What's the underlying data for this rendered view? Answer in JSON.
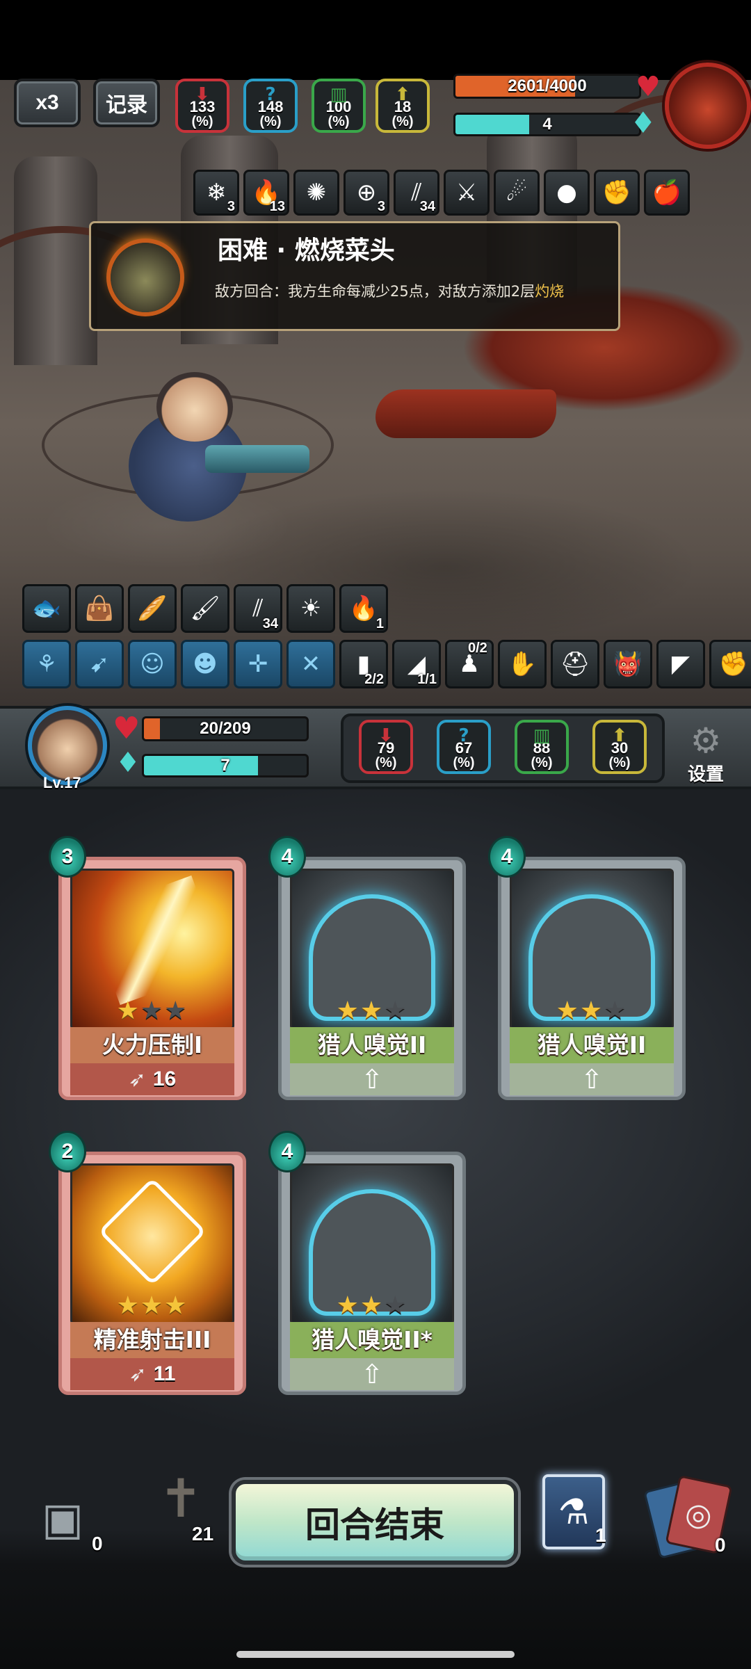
{
  "top": {
    "speed_label": "x3",
    "record_label": "记录",
    "enemy_stats": [
      {
        "icon": "attack-icon",
        "value": "133",
        "unit": "(%)",
        "color": "#c8323a"
      },
      {
        "icon": "mystery-icon",
        "value": "148",
        "unit": "(%)",
        "color": "#2a9fc8"
      },
      {
        "icon": "defense-icon",
        "value": "100",
        "unit": "(%)",
        "color": "#3aa84a"
      },
      {
        "icon": "crit-icon",
        "value": "18",
        "unit": "(%)",
        "color": "#c8b83a"
      }
    ],
    "boss_hp": {
      "text": "2601/4000",
      "fraction": 0.65,
      "color": "#e0642a"
    },
    "boss_energy": {
      "text": "4",
      "fraction": 0.4,
      "color": "#4fd8d0"
    }
  },
  "enemy_buffs": [
    {
      "icon": "snowflake-icon",
      "glyph": "❄",
      "count": "3"
    },
    {
      "icon": "burn-icon",
      "glyph": "🔥",
      "count": "13"
    },
    {
      "icon": "rage-icon",
      "glyph": "✺",
      "count": ""
    },
    {
      "icon": "target-icon",
      "glyph": "⊕",
      "count": "3"
    },
    {
      "icon": "claw-icon",
      "glyph": "⫽",
      "count": "34"
    },
    {
      "icon": "blade-icon",
      "glyph": "⚔",
      "count": ""
    },
    {
      "icon": "flaming-head-icon",
      "glyph": "☄",
      "count": ""
    },
    {
      "icon": "bomb-icon",
      "glyph": "●",
      "count": ""
    },
    {
      "icon": "fist-icon",
      "glyph": "✊",
      "count": ""
    },
    {
      "icon": "apple-icon",
      "glyph": "🍎",
      "count": ""
    }
  ],
  "tooltip": {
    "title": "困难 · 燃烧菜头",
    "desc_prefix": "敌方回合：我方生命每减少25点，对敌方添加2层",
    "keyword": "灼烧"
  },
  "player_buffs": [
    {
      "icon": "fish-icon",
      "glyph": "🐟",
      "count": ""
    },
    {
      "icon": "bag-icon",
      "glyph": "👜",
      "count": ""
    },
    {
      "icon": "bread-icon",
      "glyph": "🥖",
      "count": ""
    },
    {
      "icon": "brush-icon",
      "glyph": "🖌",
      "count": ""
    },
    {
      "icon": "claw-icon",
      "glyph": "⫽",
      "count": "34"
    },
    {
      "icon": "sun-icon",
      "glyph": "☀",
      "count": ""
    },
    {
      "icon": "burn-icon",
      "glyph": "🔥",
      "count": "1"
    }
  ],
  "player_equipment": [
    {
      "icon": "sprout-icon",
      "glyph": "⚘",
      "count": "",
      "blue": true
    },
    {
      "icon": "bow-icon",
      "glyph": "➹",
      "count": "",
      "blue": true
    },
    {
      "icon": "mask-icon",
      "glyph": "☺",
      "count": "",
      "blue": true
    },
    {
      "icon": "pumpkin-icon",
      "glyph": "☻",
      "count": "",
      "blue": true
    },
    {
      "icon": "crosshair-icon",
      "glyph": "✛",
      "count": "",
      "blue": true
    },
    {
      "icon": "crossed-arrows-icon",
      "glyph": "✕",
      "count": "",
      "blue": true
    },
    {
      "icon": "bullet-icon",
      "glyph": "▮",
      "count": "2/2",
      "blue": false
    },
    {
      "icon": "shell-icon",
      "glyph": "◢",
      "count": "1/1",
      "blue": false
    },
    {
      "icon": "figure-icon",
      "glyph": "♟",
      "count": "0/2",
      "blue": false,
      "top": true
    },
    {
      "icon": "glove-icon",
      "glyph": "✋",
      "count": "",
      "blue": false
    },
    {
      "icon": "helmet-icon",
      "glyph": "⛑",
      "count": "",
      "blue": false
    },
    {
      "icon": "monster-icon",
      "glyph": "👹",
      "count": "",
      "blue": false
    },
    {
      "icon": "gun-icon",
      "glyph": "◤",
      "count": "",
      "blue": false
    },
    {
      "icon": "gauntlet-icon",
      "glyph": "✊",
      "count": "",
      "blue": false
    }
  ],
  "player": {
    "level": "Lv.17",
    "hp": {
      "text": "20/209",
      "fraction": 0.1,
      "color": "#e0642a"
    },
    "energy": {
      "text": "7",
      "fraction": 0.7,
      "color": "#4fd8d0"
    },
    "stats": [
      {
        "icon": "attack-icon",
        "value": "79",
        "unit": "(%)",
        "color": "#c8323a"
      },
      {
        "icon": "mystery-icon",
        "value": "67",
        "unit": "(%)",
        "color": "#2a9fc8"
      },
      {
        "icon": "defense-icon",
        "value": "88",
        "unit": "(%)",
        "color": "#3aa84a"
      },
      {
        "icon": "crit-icon",
        "value": "30",
        "unit": "(%)",
        "color": "#c8b83a"
      }
    ],
    "settings_label": "设置"
  },
  "cards": [
    {
      "name": "火力压制I",
      "cost": "3",
      "stars": 1,
      "max_stars": 3,
      "style": "red",
      "art": "fire",
      "power": "16"
    },
    {
      "name": "猎人嗅觉II",
      "cost": "4",
      "stars": 2,
      "max_stars": 3,
      "style": "grey",
      "art": "hunter",
      "power": ""
    },
    {
      "name": "猎人嗅觉II",
      "cost": "4",
      "stars": 2,
      "max_stars": 3,
      "style": "grey",
      "art": "hunter",
      "power": ""
    },
    {
      "name": "精准射击III",
      "cost": "2",
      "stars": 3,
      "max_stars": 3,
      "style": "red",
      "art": "aim",
      "power": "11"
    },
    {
      "name": "猎人嗅觉II*",
      "cost": "4",
      "stars": 2,
      "max_stars": 3,
      "style": "grey",
      "art": "hunter",
      "power": ""
    }
  ],
  "bottom": {
    "draw_pile_count": "0",
    "discard_pile_count": "21",
    "end_turn_label": "回合结束",
    "potion_count": "1",
    "exhaust_pile_count": "0"
  }
}
